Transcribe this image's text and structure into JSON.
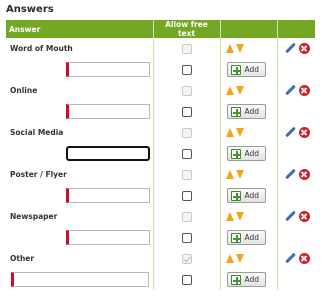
{
  "section_title": "Answers",
  "columns": {
    "answer": "Answer",
    "allow_free_text": "Allow free text"
  },
  "add_label": "Add",
  "answers": [
    {
      "name": "Word of Mouth",
      "allow_free_text": false,
      "free_text_value": ""
    },
    {
      "name": "Online",
      "allow_free_text": false,
      "free_text_value": ""
    },
    {
      "name": "Social Media",
      "allow_free_text": false,
      "free_text_value": ""
    },
    {
      "name": "Poster / Flyer",
      "allow_free_text": false,
      "free_text_value": ""
    },
    {
      "name": "Newspaper",
      "allow_free_text": false,
      "free_text_value": ""
    },
    {
      "name": "Other",
      "allow_free_text": true,
      "free_text_value": ""
    }
  ],
  "colors": {
    "header_bg": "#74a824",
    "required_marker": "#c8102e",
    "arrow": "#f2a51a",
    "delete": "#d21e2b",
    "edit": "#3b6fb6"
  },
  "icons": [
    "arrow-up-icon",
    "arrow-down-icon",
    "plus-icon",
    "pencil-icon",
    "delete-icon"
  ]
}
